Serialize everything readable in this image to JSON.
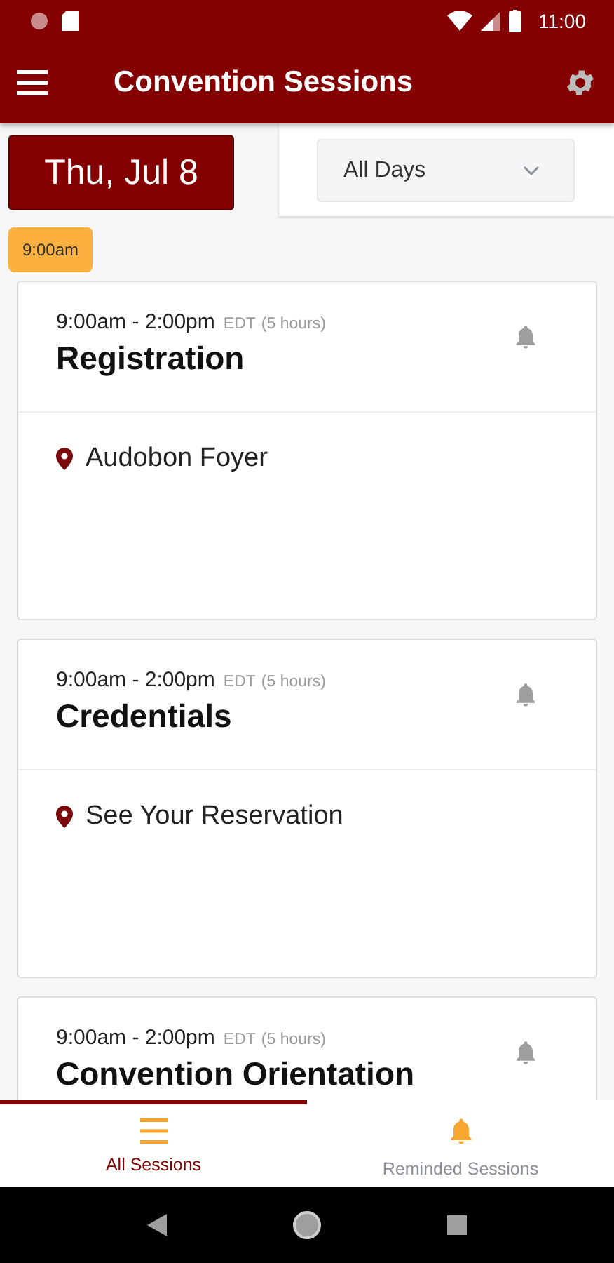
{
  "status_bar": {
    "time": "11:00"
  },
  "app_bar": {
    "title": "Convention Sessions"
  },
  "date_button": {
    "label": "Thu, Jul 8"
  },
  "day_filter": {
    "value": "All Days"
  },
  "time_chip": "9:00am",
  "sessions": [
    {
      "time": "9:00am - 2:00pm",
      "zone": "EDT",
      "duration": "(5 hours)",
      "title": "Registration",
      "location": "Audobon Foyer",
      "reminded": false
    },
    {
      "time": "9:00am - 2:00pm",
      "zone": "EDT",
      "duration": "(5 hours)",
      "title": "Credentials",
      "location": "See Your Reservation",
      "reminded": false
    },
    {
      "time": "9:00am - 2:00pm",
      "zone": "EDT",
      "duration": "(5 hours)",
      "title": "Convention Orientation",
      "reminded": false
    }
  ],
  "bottom_tabs": [
    {
      "label": "All Sessions",
      "kind": "list",
      "selected": true
    },
    {
      "label": "Reminded Sessions",
      "kind": "bell",
      "selected": false
    }
  ]
}
